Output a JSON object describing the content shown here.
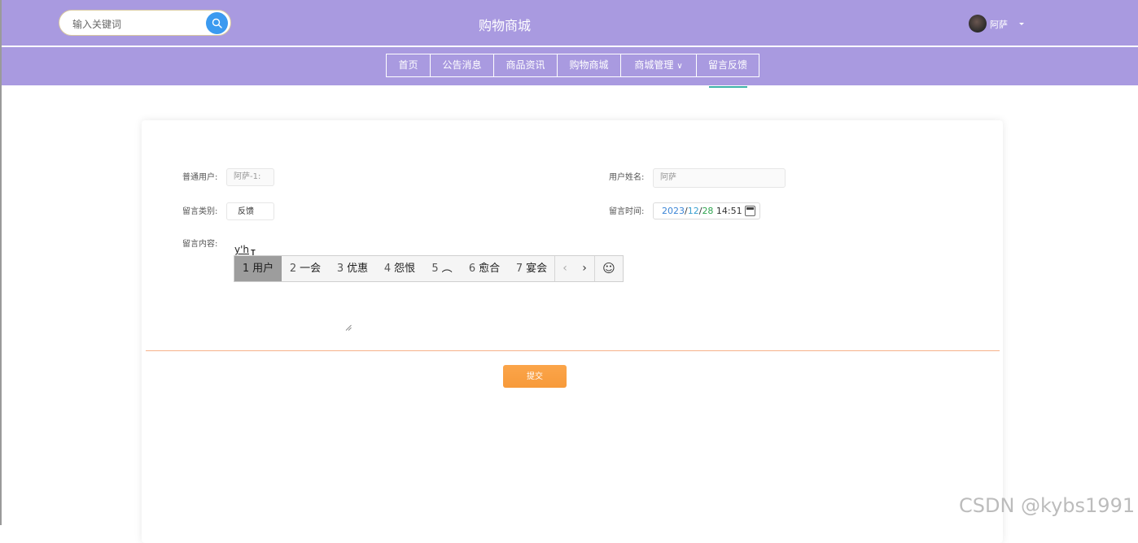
{
  "header": {
    "search": {
      "placeholder": "输入关键词",
      "icon": "search-icon"
    },
    "site_title": "购物商城",
    "user": {
      "name": "阿萨",
      "icon": "caret-down-icon"
    }
  },
  "nav": {
    "items": [
      {
        "label": "首页"
      },
      {
        "label": "公告消息"
      },
      {
        "label": "商品资讯"
      },
      {
        "label": "购物商城"
      },
      {
        "label": "商城管理",
        "chevron": "∨"
      },
      {
        "label": "留言反馈",
        "active": true
      }
    ]
  },
  "form": {
    "ordinary_user": {
      "label": "普通用户:",
      "value": "阿萨-1:"
    },
    "user_name": {
      "label": "用户姓名:",
      "value": "阿萨"
    },
    "category": {
      "label": "留言类别:",
      "value": "反馈"
    },
    "message_time": {
      "label": "留言时间:",
      "year": "2023",
      "sep1": "/",
      "month": "12",
      "sep2": "/",
      "day": "28",
      "time": " 14:51"
    },
    "content": {
      "label": "留言内容:",
      "value": "y'h"
    },
    "submit_label": "提交"
  },
  "ime": {
    "candidates": [
      {
        "num": "1",
        "text": "用户",
        "active": true
      },
      {
        "num": "2",
        "text": "一会"
      },
      {
        "num": "3",
        "text": "优惠"
      },
      {
        "num": "4",
        "text": "怨恨"
      },
      {
        "num": "5",
        "text": "︵"
      },
      {
        "num": "6",
        "text": "愈合"
      },
      {
        "num": "7",
        "text": "宴会"
      }
    ],
    "prev": "‹",
    "next": "›",
    "emoji": "☺"
  },
  "watermark": "CSDN @kybs1991",
  "colors": {
    "header_bg": "#a99ae0",
    "search_button": "#3b9af0",
    "active_underline": "#3db2a8",
    "submit_button": "#f79a3a",
    "divider": "#f6b18a"
  }
}
